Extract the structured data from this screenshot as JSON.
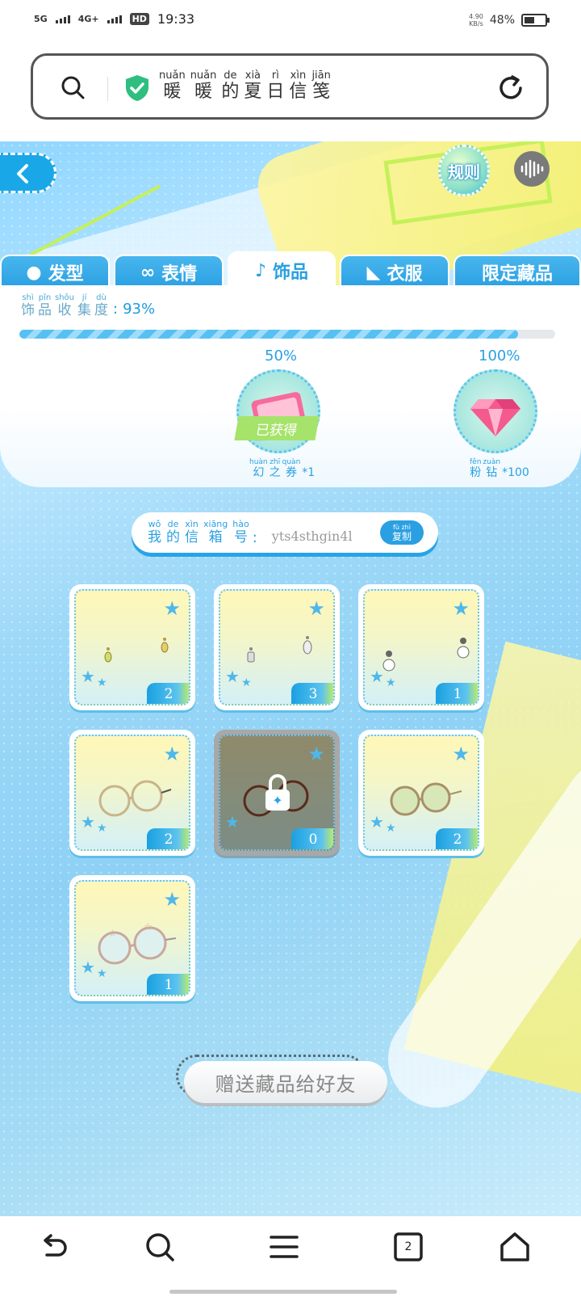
{
  "status_bar": {
    "network1": "5G",
    "network2": "4G+",
    "hd": "HD",
    "time": "19:33",
    "speed_value": "4.90",
    "speed_unit": "KB/s",
    "battery": "48%"
  },
  "browser": {
    "title_chars": [
      {
        "py": "nuǎn",
        "hz": "暖"
      },
      {
        "py": "nuǎn",
        "hz": "暖"
      },
      {
        "py": "de",
        "hz": "的"
      },
      {
        "py": "xià",
        "hz": "夏"
      },
      {
        "py": "rì",
        "hz": "日"
      },
      {
        "py": "xìn",
        "hz": "信"
      },
      {
        "py": "jiān",
        "hz": "笺"
      }
    ]
  },
  "header": {
    "rules_label": "规则"
  },
  "tabs": [
    {
      "label": "发型",
      "active": false
    },
    {
      "label": "表情",
      "active": false
    },
    {
      "label": "饰品",
      "active": true
    },
    {
      "label": "衣服",
      "active": false
    },
    {
      "label": "限定藏品",
      "active": false
    }
  ],
  "progress": {
    "label_chars": [
      {
        "py": "shì",
        "hz": "饰"
      },
      {
        "py": "pǐn",
        "hz": "品"
      },
      {
        "py": "shōu",
        "hz": "收"
      },
      {
        "py": "jí",
        "hz": "集"
      },
      {
        "py": "dù",
        "hz": "度"
      }
    ],
    "colon": ":",
    "percent_text": "93%",
    "fraction": 0.93
  },
  "milestones": [
    {
      "percent": "50%",
      "obtained_label": "已获得",
      "reward_chars": [
        {
          "py": "huàn",
          "hz": "幻"
        },
        {
          "py": "zhī",
          "hz": "之"
        },
        {
          "py": "quàn",
          "hz": "券"
        }
      ],
      "count": "*1"
    },
    {
      "percent": "100%",
      "reward_chars": [
        {
          "py": "fěn",
          "hz": "粉"
        },
        {
          "py": "zuàn",
          "hz": "钻"
        }
      ],
      "count": "*100"
    }
  ],
  "mailbox": {
    "label_chars": [
      {
        "py": "wǒ",
        "hz": "我"
      },
      {
        "py": "de",
        "hz": "的"
      },
      {
        "py": "xìn",
        "hz": "信"
      },
      {
        "py": "xiāng",
        "hz": "箱"
      },
      {
        "py": "hào",
        "hz": "号"
      }
    ],
    "colon": ":",
    "code": "yts4sthgin4l",
    "copy_py": "fù zhì",
    "copy_hz": "复制"
  },
  "items": [
    {
      "name": "earring-gold",
      "count": "2",
      "locked": false
    },
    {
      "name": "earring-silver",
      "count": "3",
      "locked": false
    },
    {
      "name": "earring-pearl",
      "count": "1",
      "locked": false
    },
    {
      "name": "glasses-round-gold",
      "count": "2",
      "locked": false
    },
    {
      "name": "glasses-round-dark",
      "count": "0",
      "locked": true
    },
    {
      "name": "glasses-tinted",
      "count": "2",
      "locked": false
    },
    {
      "name": "glasses-star",
      "count": "1",
      "locked": false
    }
  ],
  "gift_button": "赠送藏品给好友",
  "nav": {
    "tabs_count": "2"
  },
  "colors": {
    "accent": "#2aa0e2",
    "yellow": "#f4ef64",
    "green": "#c6f05a"
  }
}
